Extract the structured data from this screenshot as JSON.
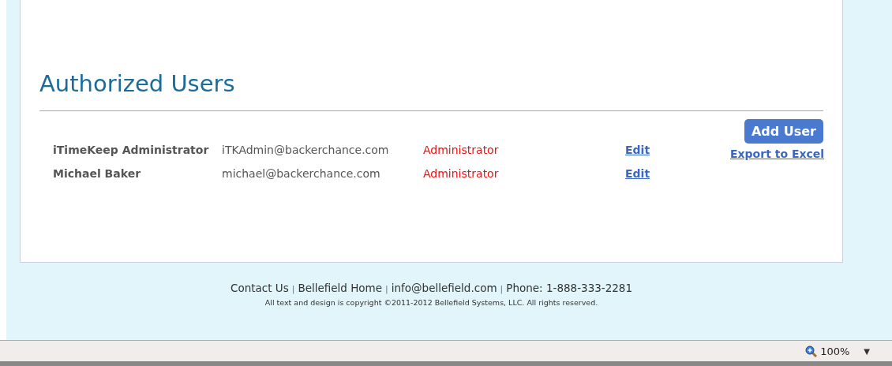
{
  "page": {
    "title": "Authorized Users",
    "add_button": "Add User",
    "export_link": "Export to Excel",
    "users": [
      {
        "name": "iTimeKeep Administrator",
        "email": "iTKAdmin@backerchance.com",
        "role": "Administrator",
        "action": "Edit"
      },
      {
        "name": "Michael Baker",
        "email": "michael@backerchance.com",
        "role": "Administrator",
        "action": "Edit"
      }
    ]
  },
  "footer": {
    "items": [
      {
        "kind": "link",
        "text": "Contact Us"
      },
      {
        "kind": "separator",
        "text": "|"
      },
      {
        "kind": "link",
        "text": "Bellefield Home"
      },
      {
        "kind": "separator",
        "text": "|"
      },
      {
        "kind": "link",
        "text": "info@bellefield.com"
      },
      {
        "kind": "separator",
        "text": "|"
      },
      {
        "kind": "text",
        "text": "Phone: 1-888-333-2281"
      }
    ],
    "copyright": "All text and design is copyright ©2011-2012 Bellefield Systems, LLC. All rights reserved."
  },
  "status_bar": {
    "zoom": "100%",
    "dropdown": "▼"
  }
}
